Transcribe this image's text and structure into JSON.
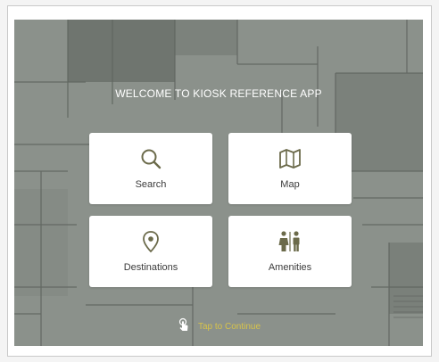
{
  "app": {
    "welcome_title": "WELCOME TO KIOSK REFERENCE APP"
  },
  "tiles": [
    {
      "label": "Search",
      "icon": "search-icon"
    },
    {
      "label": "Map",
      "icon": "map-icon"
    },
    {
      "label": "Destinations",
      "icon": "location-pin-icon"
    },
    {
      "label": "Amenities",
      "icon": "restroom-icon"
    }
  ],
  "footer": {
    "continue_label": "Tap to Continue",
    "icon": "tap-hand-icon"
  },
  "colors": {
    "background_map": "#8b918b",
    "tile_background": "#ffffff",
    "icon_color": "#6b6a4a",
    "continue_text": "#d7c34a"
  }
}
